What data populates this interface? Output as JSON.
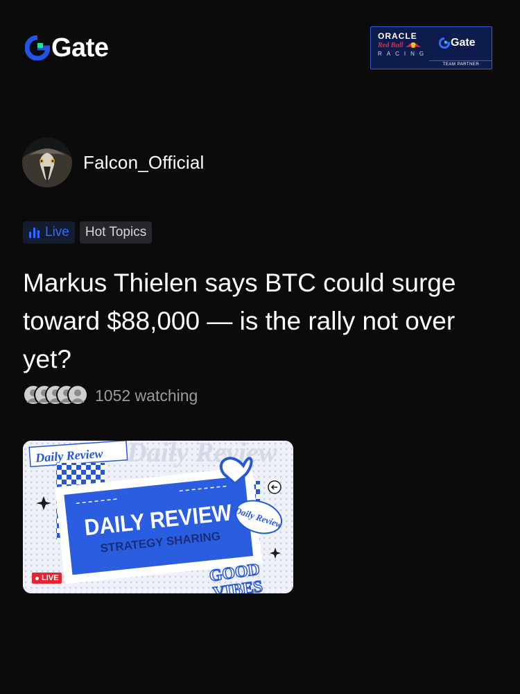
{
  "header": {
    "logo_text": "Gate",
    "partner": {
      "oracle": "ORACLE",
      "redbull": "Red Bull",
      "racing": "RACING",
      "gate": "Gate",
      "team_partner": "TEAM PARTNER"
    }
  },
  "author": {
    "name": "Falcon_Official",
    "avatar_icon": "falcon-avatar"
  },
  "tags": {
    "live": "Live",
    "topic": "Hot Topics"
  },
  "post": {
    "title": "Markus Thielen says BTC could surge toward $88,000 — is the rally not over yet?",
    "watching": "1052 watching"
  },
  "thumbnail": {
    "corner_label": "Daily Review",
    "bg_text": "Daily Review",
    "headline": "DAILY REVIEW",
    "subline": "STRATEGY SHARING",
    "sticker": "Daily Review",
    "good": "GOOD",
    "vibes": "VIBES",
    "live_badge": "LIVE"
  },
  "colors": {
    "background": "#0b0b0c",
    "accent_blue": "#2f6bff",
    "gate_green": "#17e6a1",
    "live_red": "#e0262f"
  }
}
